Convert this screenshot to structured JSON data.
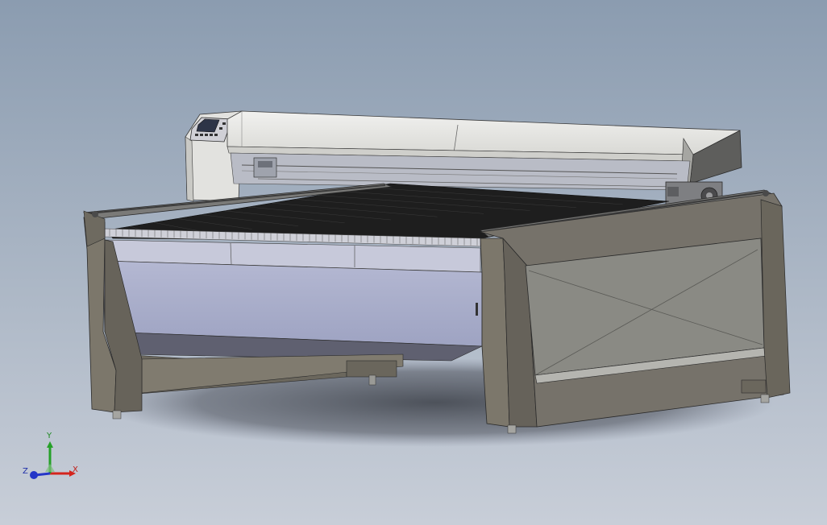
{
  "viewport": {
    "background_top": "#8b9cb0",
    "background_bottom": "#c8ced8"
  },
  "model": {
    "name": "",
    "colors": {
      "frame_leg": "#7c776b",
      "frame_leg_dark": "#5d594f",
      "side_panel": "#8a8a84",
      "front_panel": "#a9adc9",
      "gantry_cover": "#e9e9e6",
      "gantry_shadow": "#b8b8b3",
      "bed_grid": "#1c1c1c",
      "rail": "#585858",
      "shadow": "#40444c"
    }
  },
  "triad": {
    "x_label": "X",
    "y_label": "Y",
    "z_label": "Z",
    "x_color": "#d4241c",
    "y_color": "#25a028",
    "z_color": "#2436c8"
  }
}
